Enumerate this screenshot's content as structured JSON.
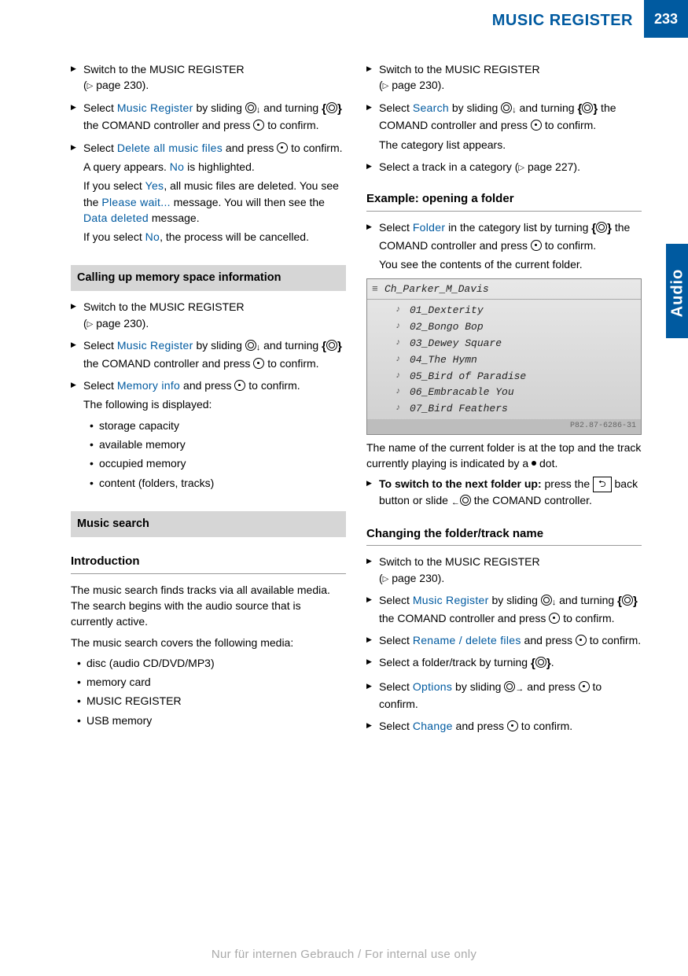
{
  "header": {
    "title": "MUSIC REGISTER",
    "page": "233",
    "side_tab": "Audio"
  },
  "left": {
    "s1_switch": "Switch to the MUSIC REGISTER",
    "s1_ref": "page 230).",
    "s2a": "Select ",
    "s2_menu": "Music Register",
    "s2b": " by sliding ",
    "s2c": " and turning ",
    "s2d": " the COMAND controller and press ",
    "s2e": " to confirm.",
    "s3a": "Select ",
    "s3_menu": "Delete all music files",
    "s3b": " and press ",
    "s3c": " to confirm.",
    "s3_query": "A query appears. ",
    "s3_no": "No",
    "s3_query2": " is highlighted.",
    "s3_yes_a": "If you select ",
    "s3_yes": "Yes",
    "s3_yes_b": ", all music files are deleted. You see the ",
    "s3_wait": "Please wait...",
    "s3_yes_c": " message. You will then see the ",
    "s3_deleted": "Data deleted",
    "s3_yes_d": " message.",
    "s3_no_a": "If you select ",
    "s3_no2": "No",
    "s3_no_b": ", the process will be cancelled.",
    "gray1": "Calling up memory space information",
    "m1_switch": "Switch to the MUSIC REGISTER",
    "m1_ref": "page 230).",
    "m2a": "Select ",
    "m2_menu": "Music Register",
    "m2b": " by sliding ",
    "m2c": " and turning ",
    "m2d": " the COMAND controller and press ",
    "m2e": " to confirm.",
    "m3a": "Select ",
    "m3_menu": "Memory info",
    "m3b": " and press ",
    "m3c": " to confirm.",
    "m3_disp": "The following is displayed:",
    "m3_b1": "storage capacity",
    "m3_b2": "available memory",
    "m3_b3": "occupied memory",
    "m3_b4": "content (folders, tracks)",
    "gray2": "Music search",
    "ms_intro_h": "Introduction",
    "ms_p1": "The music search finds tracks via all available media. The search begins with the audio source that is currently active.",
    "ms_p2": "The music search covers the following media:",
    "ms_b1": "disc (audio CD/DVD/MP3)",
    "ms_b2": "memory card",
    "ms_b3": "MUSIC REGISTER",
    "ms_b4": "USB memory"
  },
  "right": {
    "r1_switch": "Switch to the MUSIC REGISTER",
    "r1_ref": "page 230).",
    "r2a": "Select ",
    "r2_menu": "Search",
    "r2b": " by sliding ",
    "r2c": " and turning ",
    "r2d": " the COMAND controller and press ",
    "r2e": " to confirm.",
    "r2_cat": "The category list appears.",
    "r3a": "Select a track in a category (",
    "r3b": "page 227).",
    "sect1": "Example: opening a folder",
    "f1a": "Select ",
    "f1_menu": "Folder",
    "f1b": " in the category list by turning ",
    "f1c": " the COMAND controller and press ",
    "f1d": " to confirm.",
    "f1_res": "You see the contents of the current folder.",
    "scr_title": "Ch_Parker_M_Davis",
    "scr_items": [
      "01_Dexterity",
      "02_Bongo Bop",
      "03_Dewey Square",
      "04_The Hymn",
      "05_Bird of Paradise",
      "06_Embracable You",
      "07_Bird Feathers"
    ],
    "scr_ref": "P82.87-6286-31",
    "cap_a": "The name of the current folder is at the top and the track currently playing is indicated by a ",
    "cap_b": " dot.",
    "up_a": "To switch to the next folder up:",
    "up_b": " press the ",
    "up_c": " back button or slide ",
    "up_d": " the COMAND controller.",
    "sect2": "Changing the folder/track name",
    "c1_switch": "Switch to the MUSIC REGISTER",
    "c1_ref": "page 230).",
    "c2a": "Select ",
    "c2_menu": "Music Register",
    "c2b": " by sliding ",
    "c2c": " and turning ",
    "c2d": " the COMAND controller and press ",
    "c2e": " to confirm.",
    "c3a": "Select ",
    "c3_menu": "Rename / delete files",
    "c3b": " and press ",
    "c3c": " to confirm.",
    "c4a": "Select a folder/track by turning ",
    "c4b": ".",
    "c5a": "Select ",
    "c5_menu": "Options",
    "c5b": " by sliding ",
    "c5c": " and press ",
    "c5d": " to confirm.",
    "c6a": "Select ",
    "c6_menu": "Change",
    "c6b": " and press ",
    "c6c": " to confirm."
  },
  "watermark": "Nur für internen Gebrauch / For internal use only"
}
